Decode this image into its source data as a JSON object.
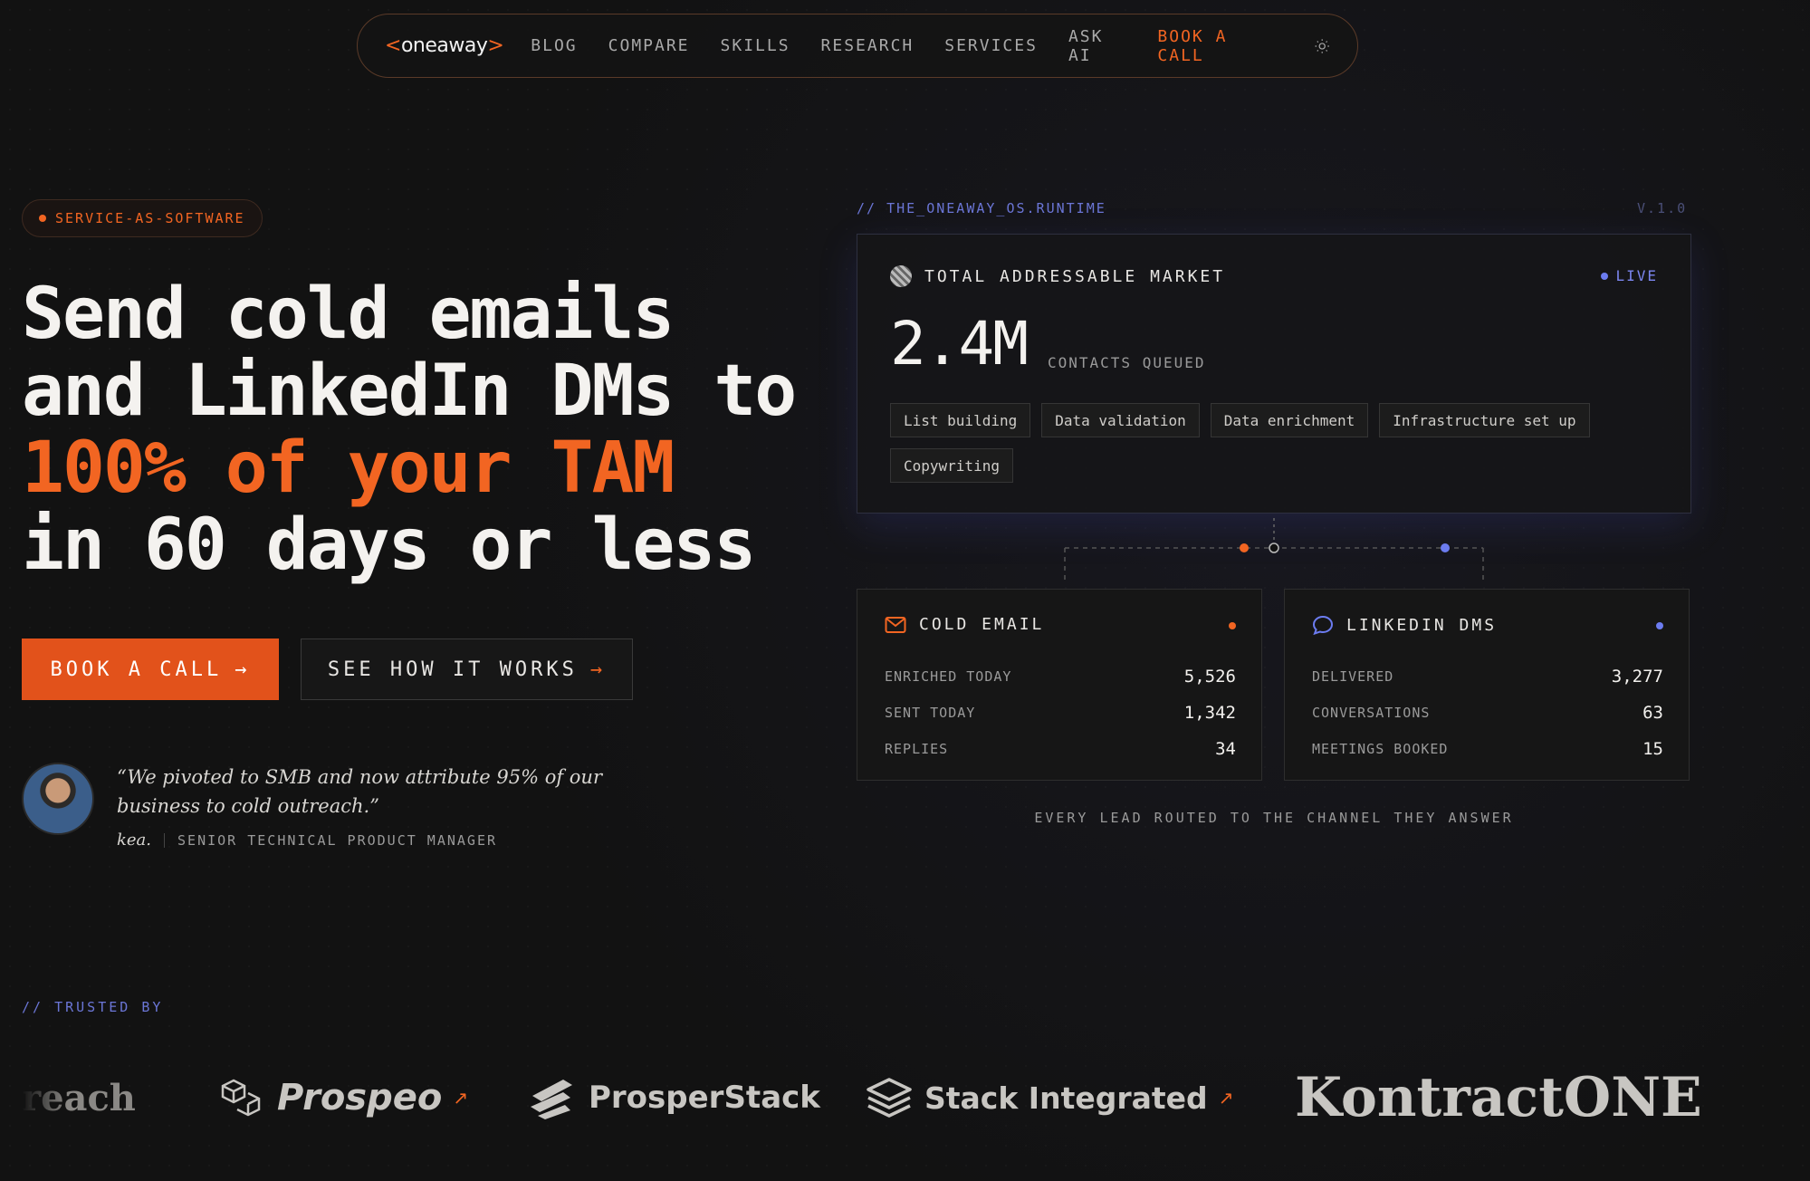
{
  "nav": {
    "logo": "<oneaway>",
    "logo_open": "<",
    "logo_text": "oneaway",
    "logo_close": ">",
    "items": [
      {
        "label": "BLOG"
      },
      {
        "label": "COMPARE"
      },
      {
        "label": "SKILLS"
      },
      {
        "label": "RESEARCH"
      },
      {
        "label": "SERVICES"
      },
      {
        "label": "ASK AI"
      }
    ],
    "cta": "BOOK A CALL",
    "theme_icon": "sun-icon"
  },
  "hero": {
    "badge": "SERVICE-AS-SOFTWARE",
    "headline_1": "Send cold emails",
    "headline_2": "and LinkedIn DMs to",
    "headline_3": "100% of your TAM",
    "headline_4": "in 60 days or less",
    "primary_button": "BOOK A CALL",
    "secondary_button": "SEE HOW IT WORKS",
    "arrow": "→"
  },
  "testimonial": {
    "quote": "“We pivoted to SMB and now attribute 95% of our business to cold outreach.”",
    "name": "kea.",
    "role": "SENIOR TECHNICAL PRODUCT MANAGER"
  },
  "runtime": {
    "label": "// THE_ONEAWAY_OS.RUNTIME",
    "version": "V.1.0",
    "tam": {
      "title": "TOTAL ADDRESSABLE MARKET",
      "status": "LIVE",
      "value": "2.4M",
      "caption": "CONTACTS QUEUED",
      "chips": [
        "List building",
        "Data validation",
        "Data enrichment",
        "Infrastructure set up",
        "Copywriting"
      ]
    },
    "cold_email": {
      "title": "COLD EMAIL",
      "rows": [
        {
          "label": "ENRICHED TODAY",
          "value": "5,526"
        },
        {
          "label": "SENT TODAY",
          "value": "1,342"
        },
        {
          "label": "REPLIES",
          "value": "34"
        }
      ]
    },
    "linkedin": {
      "title": "LINKEDIN DMS",
      "rows": [
        {
          "label": "DELIVERED",
          "value": "3,277"
        },
        {
          "label": "CONVERSATIONS",
          "value": "63"
        },
        {
          "label": "MEETINGS BOOKED",
          "value": "15"
        }
      ]
    },
    "footer": "EVERY LEAD ROUTED TO THE CHANNEL THEY ANSWER"
  },
  "trusted": {
    "label": "// TRUSTED BY",
    "logos": [
      "reach",
      "Prospeo",
      "ProsperStack",
      "Stack Integrated",
      "KontractONE"
    ],
    "ext_icon": "↗"
  },
  "colors": {
    "accent": "#f26522",
    "accent_blue": "#6c7cf0",
    "background": "#121212"
  }
}
